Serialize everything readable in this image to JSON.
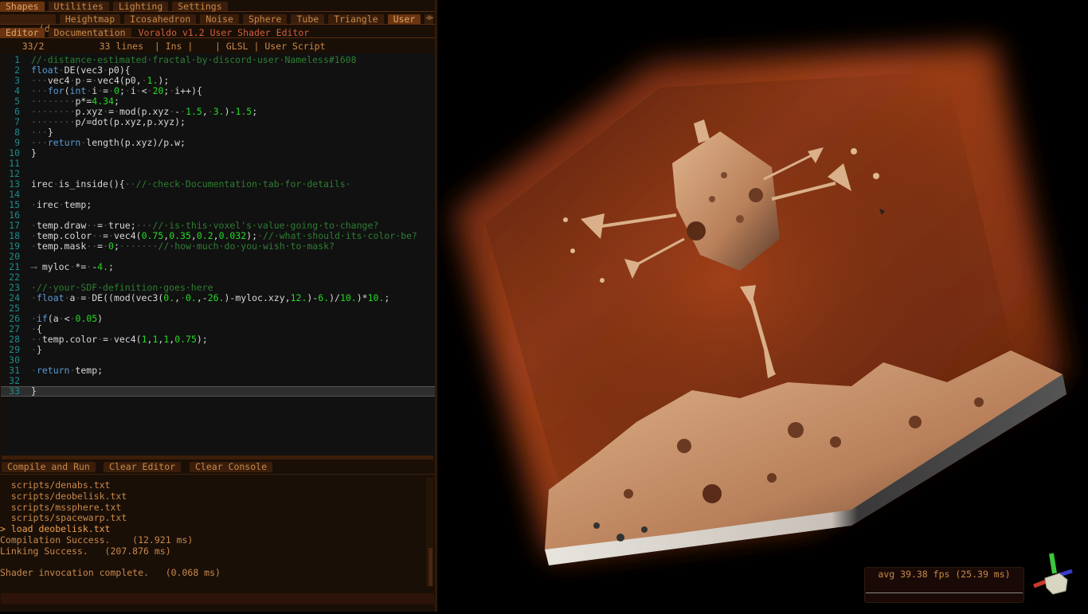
{
  "window": {
    "title": "Voraldo v1.2 User Shader Editor"
  },
  "menu": {
    "tabs": [
      {
        "label": "Shapes",
        "active": true
      },
      {
        "label": "Utilities",
        "active": false
      },
      {
        "label": "Lighting",
        "active": false
      },
      {
        "label": "Settings",
        "active": false
      }
    ]
  },
  "shape_tabs": {
    "tabs": [
      {
        "label": "id",
        "active": false
      },
      {
        "label": "Heightmap",
        "active": false
      },
      {
        "label": "Icosahedron",
        "active": false
      },
      {
        "label": "Noise",
        "active": false
      },
      {
        "label": "Sphere",
        "active": false
      },
      {
        "label": "Tube",
        "active": false
      },
      {
        "label": "Triangle",
        "active": false
      },
      {
        "label": "User",
        "active": true
      },
      {
        "label": "'",
        "active": false
      }
    ],
    "overflow_icon": "triangle-down-icon",
    "scroll_icons": "◀▶"
  },
  "editor_tabs": {
    "tabs": [
      {
        "label": "Editor",
        "active": true
      },
      {
        "label": "Documentation",
        "active": false
      }
    ],
    "title": "Voraldo v1.2 User Shader Editor"
  },
  "status": {
    "cursor": "33/2",
    "lines": "33 lines",
    "mode": "Ins",
    "language": "GLSL",
    "name": "User Script",
    "text": "    33/2          33 lines  | Ins |    | GLSL | User Script"
  },
  "code": {
    "lines": [
      "1",
      "2",
      "3",
      "4",
      "5",
      "6",
      "7",
      "8",
      "9",
      "10",
      "11",
      "12",
      "13",
      "14",
      "15",
      "16",
      "17",
      "18",
      "19",
      "20",
      "21",
      "22",
      "23",
      "24",
      "25",
      "26",
      "27",
      "28",
      "29",
      "30",
      "31",
      "32",
      "33"
    ],
    "current_line": 33,
    "source": [
      "// distance estimated fractal by discord user Nameless#1608",
      "float DE(vec3 p0){",
      "   vec4 p = vec4(p0, 1.);",
      "   for(int i = 0; i < 20; i++){",
      "        p*=4.34;",
      "        p.xyz = mod(p.xyz - 1.5, 3.)-1.5;",
      "        p/=dot(p.xyz,p.xyz);",
      "   }",
      "   return length(p.xyz)/p.w;",
      "}",
      "",
      "",
      "irec is_inside(){  // check Documentation tab for details ",
      "",
      " irec temp;",
      "",
      " temp.draw  = true;   // is this voxel's value going to change?",
      " temp.color  = vec4(0.75,0.35,0.2,0.032); // what should its color be?",
      " temp.mask  = 0;       // how much do you wish to mask?",
      "",
      "\tmyloc *= -4.;",
      "",
      " // your SDF definition goes here",
      " float a = DE((mod(vec3(0., 0.,-26.)-myloc.xzy,12.)-6.)/10.)*10.;",
      "",
      " if(a < 0.05)",
      " {",
      "  temp.color = vec4(1,1,1,0.75);",
      " }",
      "",
      " return temp;",
      "",
      "}"
    ]
  },
  "buttons": {
    "compile": "Compile and Run",
    "clear_editor": "Clear Editor",
    "clear_console": "Clear Console"
  },
  "console": {
    "lines": [
      {
        "text": "  scripts/denabs.txt",
        "type": "normal"
      },
      {
        "text": "  scripts/deobelisk.txt",
        "type": "normal"
      },
      {
        "text": "  scripts/mssphere.txt",
        "type": "normal"
      },
      {
        "text": "  scripts/spacewarp.txt",
        "type": "normal"
      },
      {
        "text": "> load deobelisk.txt",
        "type": "cmd"
      },
      {
        "text": "Compilation Success.    (12.921 ms)",
        "type": "normal"
      },
      {
        "text": "Linking Success.   (207.876 ms)",
        "type": "normal"
      },
      {
        "text": "",
        "type": "normal"
      },
      {
        "text": "Shader invocation complete.   (0.068 ms)",
        "type": "normal"
      }
    ],
    "input_value": ""
  },
  "fps": {
    "text": "avg 39.38 fps (25.39 ms)",
    "avg_fps": 39.38,
    "frame_ms": 25.39
  },
  "viewport": {
    "description": "3D volume render of fractal inside orange block",
    "colors": {
      "volume": "#a8431b",
      "volume_dark": "#6a2810",
      "surface": "#d7a983",
      "surface_light": "#e8e4de"
    },
    "orientation_gizmo": {
      "x_color": "#d03a2a",
      "y_color": "#3ac83a",
      "z_color": "#3a3ac8",
      "cube_color": "#dcdccc"
    }
  }
}
